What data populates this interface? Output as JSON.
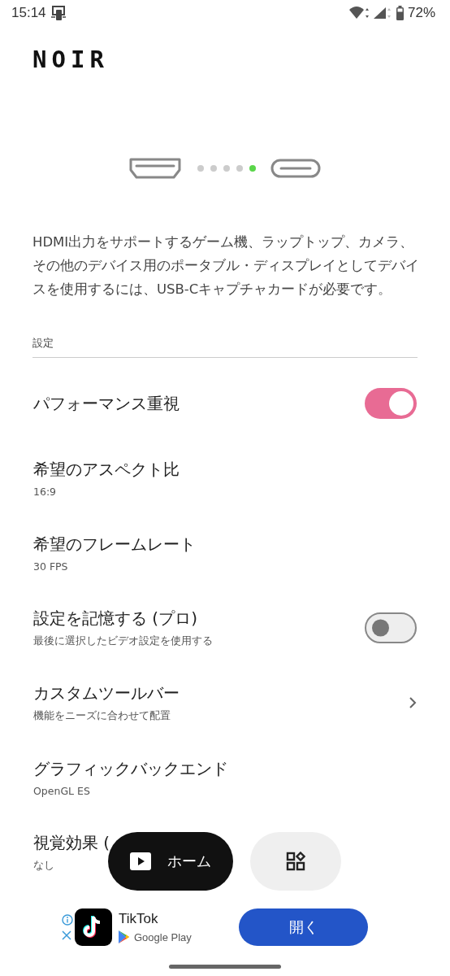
{
  "status_bar": {
    "time": "15:14",
    "battery": "72%"
  },
  "logo": "NOIR",
  "carousel": {
    "dots": [
      {
        "selected": false
      },
      {
        "selected": false
      },
      {
        "selected": false
      },
      {
        "selected": false
      },
      {
        "selected": true
      }
    ]
  },
  "description": "HDMI出力をサポートするゲーム機、ラップトップ、カメラ、その他のデバイス用のポータブル・ディスプレイとしてデバイスを使用するには、USB-Cキャプチャカードが必要です。",
  "section_title": "設定",
  "settings": [
    {
      "kind": "toggle",
      "title": "パフォーマンス重視",
      "on": true
    },
    {
      "kind": "value",
      "title": "希望のアスペクト比",
      "subtitle": "16:9"
    },
    {
      "kind": "value",
      "title": "希望のフレームレート",
      "subtitle": "30 FPS"
    },
    {
      "kind": "toggle",
      "title": "設定を記憶する (プロ)",
      "subtitle": "最後に選択したビデオ設定を使用する",
      "on": false
    },
    {
      "kind": "link",
      "title": "カスタムツールバー",
      "subtitle": "機能をニーズに合わせて配置"
    },
    {
      "kind": "value",
      "title": "グラフィックバックエンド",
      "subtitle": "OpenGL ES"
    },
    {
      "kind": "value",
      "title": "視覚効果 (",
      "subtitle": "なし"
    }
  ],
  "nav": [
    {
      "kind": "home",
      "label": "ホーム",
      "selected": true
    },
    {
      "kind": "apps",
      "selected": false
    }
  ],
  "ad": {
    "app_name": "TikTok",
    "store": "Google Play",
    "button": "開く"
  }
}
